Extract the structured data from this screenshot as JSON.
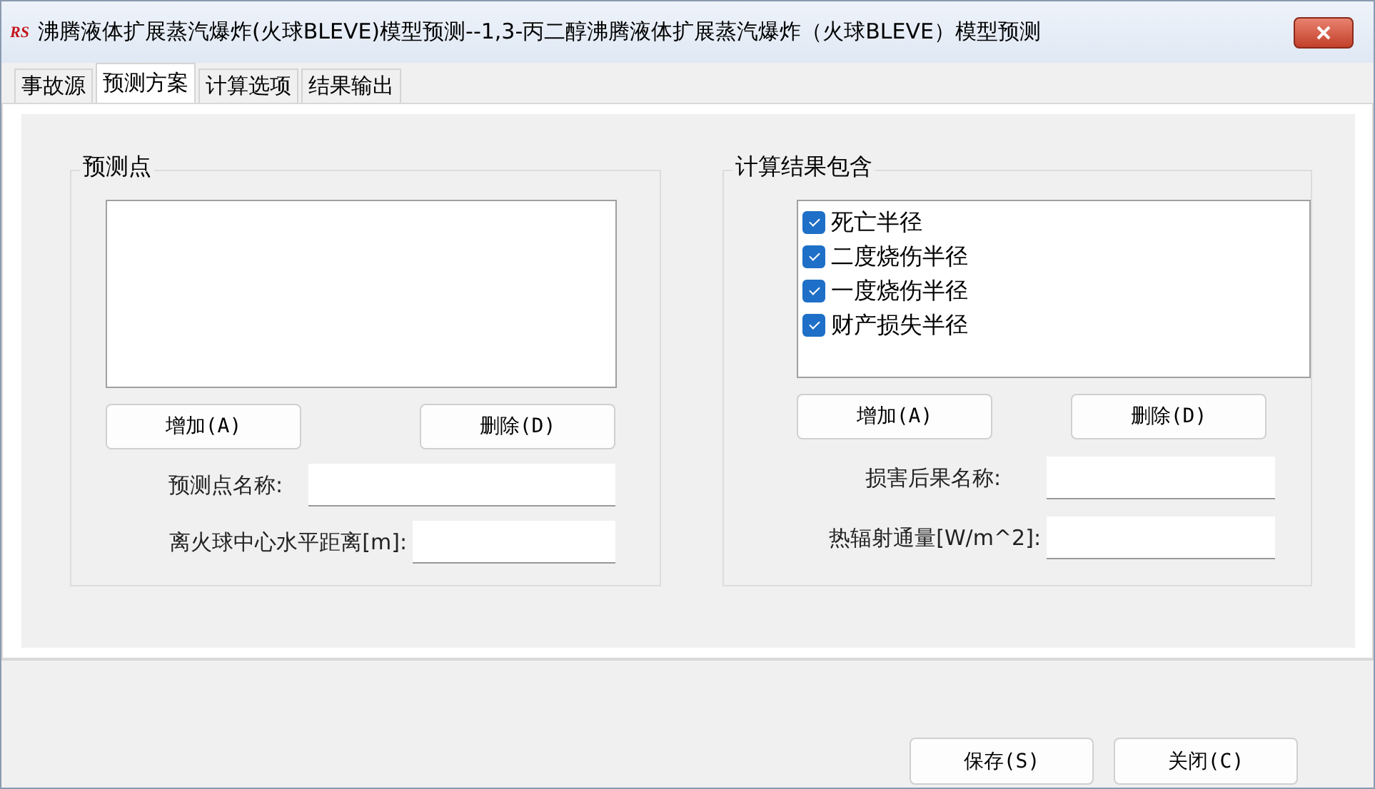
{
  "window": {
    "logo": "RS",
    "title": "沸腾液体扩展蒸汽爆炸(火球BLEVE)模型预测--1,3-丙二醇沸腾液体扩展蒸汽爆炸（火球BLEVE）模型预测"
  },
  "tabs": [
    {
      "label": "事故源",
      "selected": false
    },
    {
      "label": "预测方案",
      "selected": true
    },
    {
      "label": "计算选项",
      "selected": false
    },
    {
      "label": "结果输出",
      "selected": false
    }
  ],
  "prediction_points": {
    "title": "预测点",
    "add_button": "增加(A)",
    "delete_button": "删除(D)",
    "fields": [
      {
        "label": "预测点名称:"
      },
      {
        "label": "离火球中心水平距离[m]:"
      }
    ]
  },
  "results": {
    "title": "计算结果包含",
    "items": [
      {
        "label": "死亡半径",
        "checked": true
      },
      {
        "label": "二度烧伤半径",
        "checked": true
      },
      {
        "label": "一度烧伤半径",
        "checked": true
      },
      {
        "label": "财产损失半径",
        "checked": true
      }
    ],
    "add_button": "增加(A)",
    "delete_button": "删除(D)",
    "fields": [
      {
        "label": "损害后果名称:"
      },
      {
        "label": "热辐射通量[W/m^2]:"
      }
    ]
  },
  "buttons": [
    "保存(S)",
    "关闭(C)"
  ]
}
